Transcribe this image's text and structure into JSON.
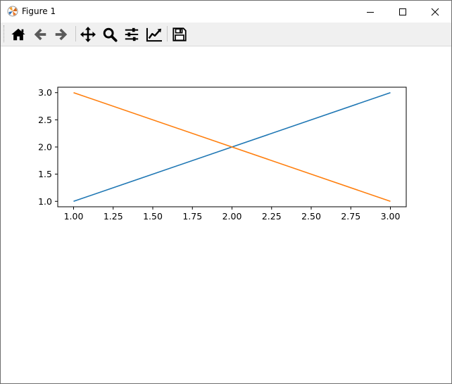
{
  "window": {
    "title": "Figure 1"
  },
  "toolbar": {
    "buttons": [
      {
        "name": "home",
        "icon": "home-icon"
      },
      {
        "name": "back",
        "icon": "arrow-left-icon"
      },
      {
        "name": "forward",
        "icon": "arrow-right-icon"
      },
      {
        "name": "pan",
        "icon": "move-icon"
      },
      {
        "name": "zoom",
        "icon": "magnifier-icon"
      },
      {
        "name": "subplots",
        "icon": "sliders-icon"
      },
      {
        "name": "edit-axis",
        "icon": "chart-line-icon"
      },
      {
        "name": "save",
        "icon": "floppy-disk-icon"
      }
    ]
  },
  "chart_data": {
    "type": "line",
    "xlim": [
      0.9,
      3.1
    ],
    "ylim": [
      0.9,
      3.1
    ],
    "x_ticks": [
      "1.00",
      "1.25",
      "1.50",
      "1.75",
      "2.00",
      "2.25",
      "2.50",
      "2.75",
      "3.00"
    ],
    "y_ticks": [
      "1.0",
      "1.5",
      "2.0",
      "2.5",
      "3.0"
    ],
    "series": [
      {
        "x": [
          1,
          2,
          3
        ],
        "y": [
          1,
          2,
          3
        ],
        "color": "#1f77b4"
      },
      {
        "x": [
          1,
          2,
          3
        ],
        "y": [
          3,
          2,
          1
        ],
        "color": "#ff7f0e"
      }
    ],
    "grid": false
  }
}
